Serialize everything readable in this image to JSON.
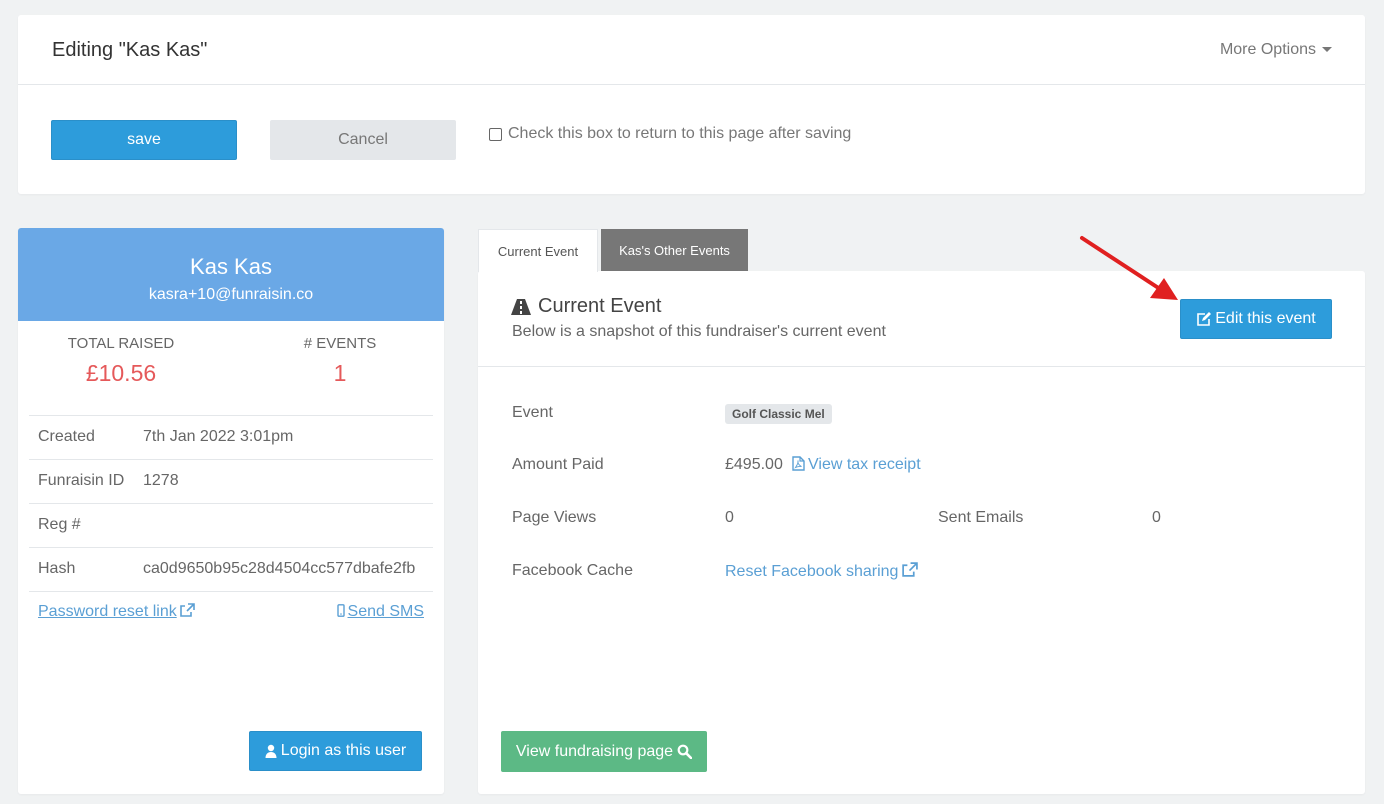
{
  "header": {
    "title": "Editing \"Kas Kas\"",
    "more_options": "More Options"
  },
  "form_actions": {
    "save": "save",
    "cancel": "Cancel",
    "return_checkbox_label": "Check this box to return to this page after saving"
  },
  "user": {
    "name": "Kas Kas",
    "email": "kasra+10@funraisin.co",
    "stats": {
      "total_raised_label": "TOTAL RAISED",
      "total_raised_value": "£10.56",
      "events_label": "# EVENTS",
      "events_value": "1"
    },
    "details": [
      {
        "key": "Created",
        "value": "7th Jan 2022 3:01pm"
      },
      {
        "key": "Funraisin ID",
        "value": "1278"
      },
      {
        "key": "Reg #",
        "value": ""
      },
      {
        "key": "Hash",
        "value": "ca0d9650b95c28d4504cc577dbafe2fb"
      }
    ],
    "password_reset_link": "Password reset link",
    "send_sms_link": "Send SMS",
    "login_button": "Login as this user"
  },
  "tabs": [
    {
      "label": "Current Event",
      "active": true
    },
    {
      "label": "Kas's Other Events",
      "active": false
    }
  ],
  "event": {
    "title": "Current Event",
    "subtitle": "Below is a snapshot of this fundraiser's current event",
    "edit_button": "Edit this event",
    "event_label": "Event",
    "event_name": "Golf Classic Mel",
    "amount_paid_label": "Amount Paid",
    "amount_paid_value": "£495.00",
    "tax_receipt_link": "View tax receipt",
    "page_views_label": "Page Views",
    "page_views_value": "0",
    "sent_emails_label": "Sent Emails",
    "sent_emails_value": "0",
    "facebook_cache_label": "Facebook Cache",
    "facebook_reset_link": "Reset Facebook sharing",
    "view_page_button": "View fundraising page"
  },
  "colors": {
    "primary": "#2d9cdb",
    "header_blue": "#6aa8e6",
    "raised_red": "#e5595a",
    "success_green": "#5cb985",
    "link_blue": "#5a9fd4",
    "annotation_arrow": "#e02020"
  },
  "icons": {
    "more_options": "caret-down-icon",
    "external_link": "external-link-icon",
    "mobile": "mobile-icon",
    "user": "user-icon",
    "road": "road-icon",
    "edit": "edit-icon",
    "pdf": "file-pdf-icon",
    "search": "search-icon",
    "annotation": "red-arrow-icon"
  }
}
